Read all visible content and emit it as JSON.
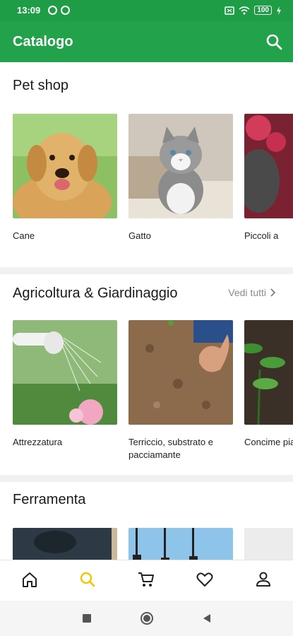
{
  "status_bar": {
    "time": "13:09",
    "battery": "100"
  },
  "app_bar": {
    "title": "Catalogo"
  },
  "sections": [
    {
      "title": "Pet shop",
      "items": [
        "Cane",
        "Gatto",
        "Piccoli a"
      ]
    },
    {
      "title": "Agricoltura & Giardinaggio",
      "see_all": "Vedi tutti",
      "items": [
        "Attrezzatura",
        "Terriccio, substrato e pacciamante",
        "Concime piante"
      ]
    },
    {
      "title": "Ferramenta",
      "items": []
    }
  ],
  "bottom_nav": {
    "items": [
      "home-icon",
      "search-icon",
      "cart-icon",
      "heart-icon",
      "user-icon"
    ],
    "active_color": "#f5c400"
  },
  "colors": {
    "primary": "#22a24a",
    "status": "#1f9d46"
  }
}
